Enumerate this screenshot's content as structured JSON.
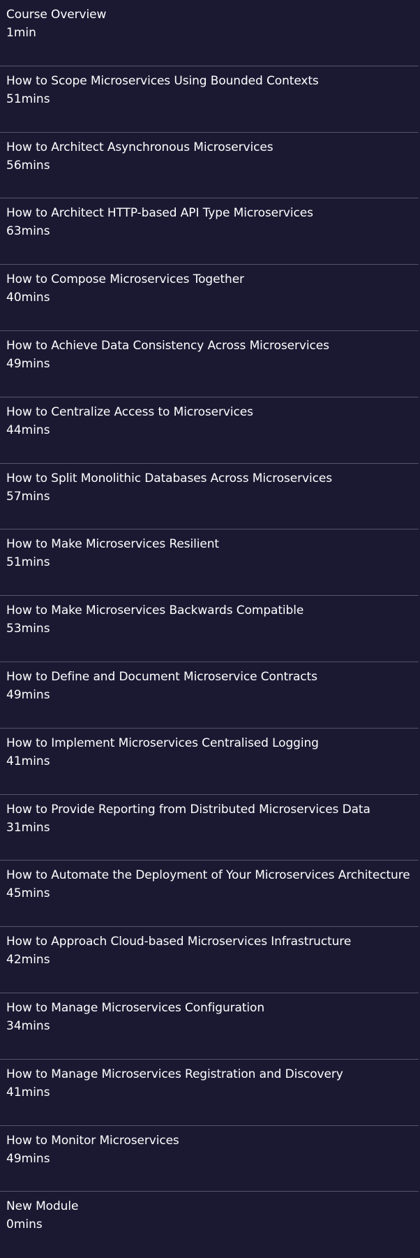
{
  "modules": [
    {
      "title": "Course Overview",
      "duration": "1min"
    },
    {
      "title": "How to Scope Microservices Using Bounded Contexts",
      "duration": "51mins"
    },
    {
      "title": "How to Architect Asynchronous Microservices",
      "duration": "56mins"
    },
    {
      "title": "How to Architect HTTP-based API Type Microservices",
      "duration": "63mins"
    },
    {
      "title": "How to Compose Microservices Together",
      "duration": "40mins"
    },
    {
      "title": "How to Achieve Data Consistency Across Microservices",
      "duration": "49mins"
    },
    {
      "title": "How to Centralize Access to Microservices",
      "duration": "44mins"
    },
    {
      "title": "How to Split Monolithic Databases Across Microservices",
      "duration": "57mins"
    },
    {
      "title": "How to Make Microservices Resilient",
      "duration": "51mins"
    },
    {
      "title": "How to Make Microservices Backwards Compatible",
      "duration": "53mins"
    },
    {
      "title": "How to Define and Document Microservice Contracts",
      "duration": "49mins"
    },
    {
      "title": "How to Implement Microservices Centralised Logging",
      "duration": "41mins"
    },
    {
      "title": "How to Provide Reporting from Distributed Microservices Data",
      "duration": "31mins"
    },
    {
      "title": "How to Automate the Deployment of Your Microservices Architecture",
      "duration": "45mins"
    },
    {
      "title": "How to Approach Cloud-based Microservices Infrastructure",
      "duration": "42mins"
    },
    {
      "title": "How to Manage Microservices Configuration",
      "duration": "34mins"
    },
    {
      "title": "How to Manage Microservices Registration and Discovery",
      "duration": "41mins"
    },
    {
      "title": "How to Monitor Microservices",
      "duration": "49mins"
    },
    {
      "title": "New Module",
      "duration": "0mins"
    }
  ]
}
